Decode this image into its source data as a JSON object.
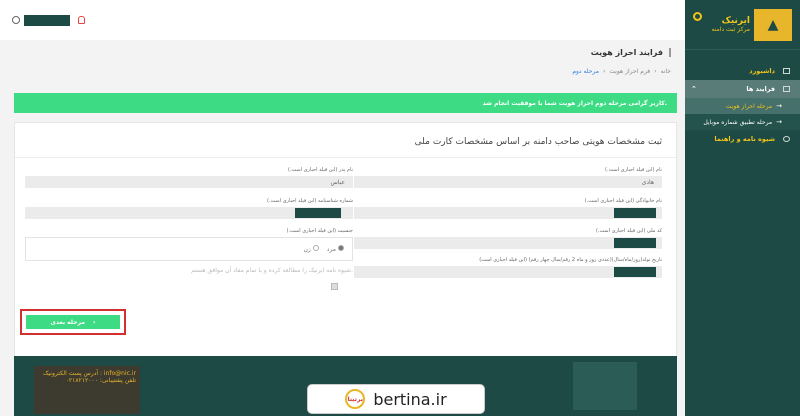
{
  "brand": {
    "name": "ایرنیک",
    "sub": "مرکز ثبت دامنه"
  },
  "sidebar": {
    "items": [
      {
        "label": "داشبورد"
      },
      {
        "label": "فرایند ها"
      },
      {
        "label": "شیوه نامه و راهنما"
      }
    ],
    "sub_items": [
      {
        "label": "مرحله احراز هویت"
      },
      {
        "label": "مرحله تطبیق شماره موبایل"
      }
    ]
  },
  "page": {
    "title": "فرایند احراز هویت",
    "breadcrumb": [
      "خانه",
      "فرم احراز هویت",
      "مرحله دوم"
    ]
  },
  "alert": {
    "text": "کاربر گرامی مرحله دوم احراز هویت شما با موفقیت انجام شد."
  },
  "form": {
    "title": "ثبت مشخصات هویتی صاحب دامنه بر اساس مشخصات کارت ملی",
    "first_name_label": "نام (این فیلد اجباری است.)",
    "first_name_value": "هادی",
    "last_name_label": "نام خانوادگی (این فیلد اجباری است.)",
    "national_code_label": "کد ملی (این فیلد اجباری است.)",
    "birth_date_label": "تاریخ تولد(روز/ماه/سال)(عددی روز و ماه 2 رقم/سال چهار رقم) (این فیلد اجباری است)",
    "father_name_label": "نام پدر (این فیلد اجباری است.)",
    "father_name_value": "عباس",
    "id_number_label": "شماره شناسنامه (این فیلد اجباری است.)",
    "gender_label": "جنسیت (این فیلد اجباری است.)",
    "gender_male": "مرد",
    "gender_female": "زن",
    "agree_text": "شیوه نامه ایرنیک را مطالعه کرده و با تمام مفاد آن موافق هستم.",
    "next_button": "مرحله بعدی"
  },
  "footer": {
    "address": "آدرس پست الکترونیک : info@nic.ir",
    "phone": "تلفن پشتیبانی: ۰۲۱۸۲۱۲۰۰۰"
  },
  "watermark": {
    "text": "bertina.ir",
    "logo_text": "برتینا"
  }
}
